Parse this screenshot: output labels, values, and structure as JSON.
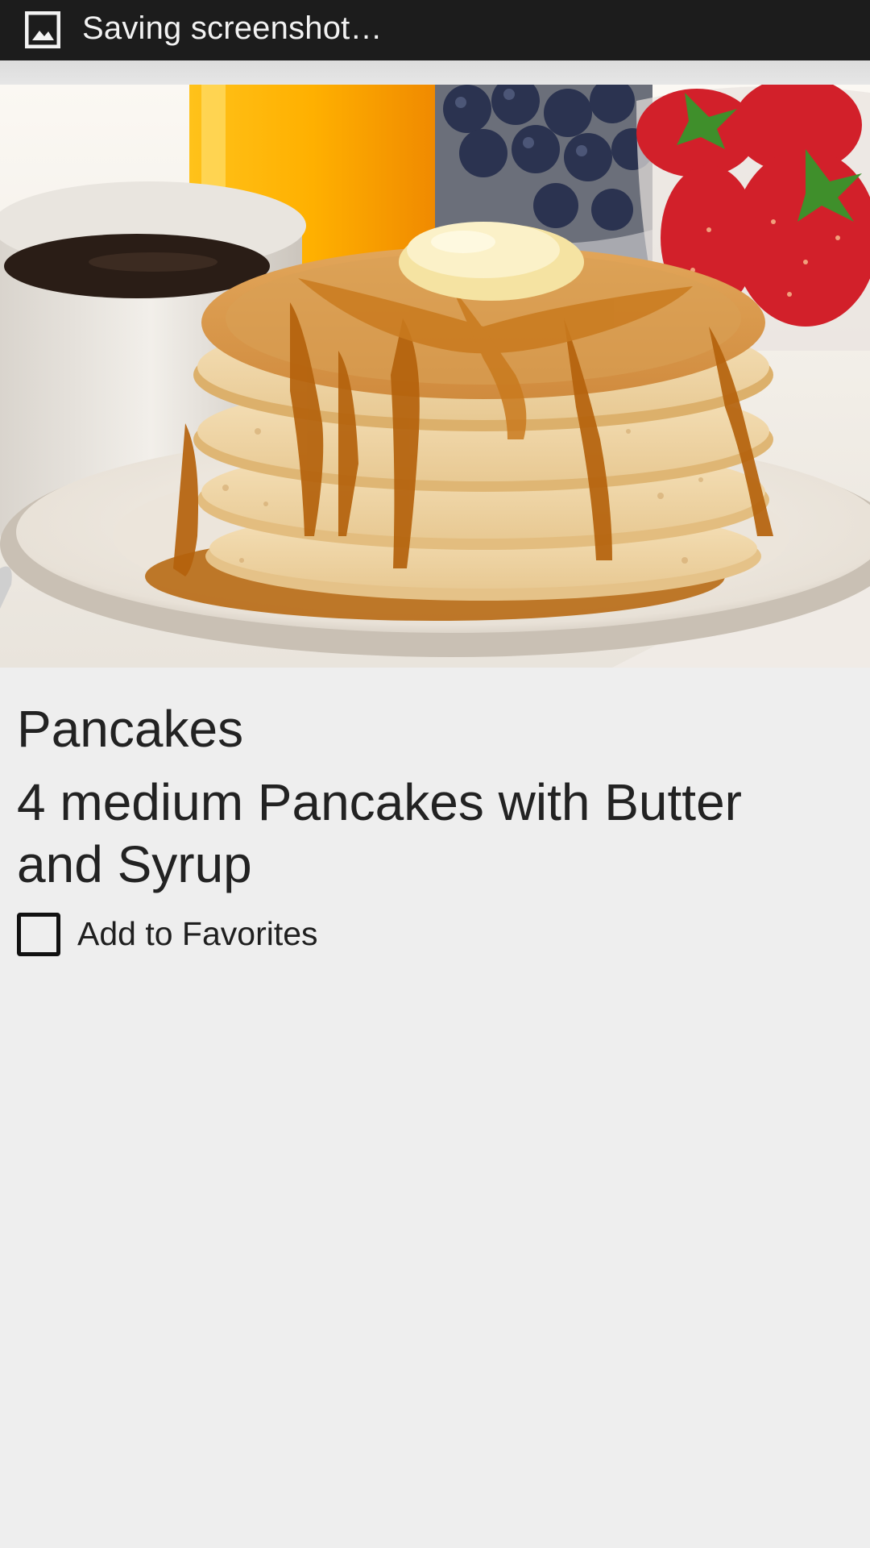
{
  "status_bar": {
    "icon": "image-icon",
    "notification": "Saving screenshot…"
  },
  "item": {
    "image": "pancakes-photo",
    "title": "Pancakes",
    "description": "4 medium Pancakes with Butter and Syrup"
  },
  "favorites": {
    "label": "Add to Favorites",
    "checked": false
  },
  "colors": {
    "status_bar": "#1c1c1c",
    "background": "#eeeeee",
    "text": "#222222"
  }
}
